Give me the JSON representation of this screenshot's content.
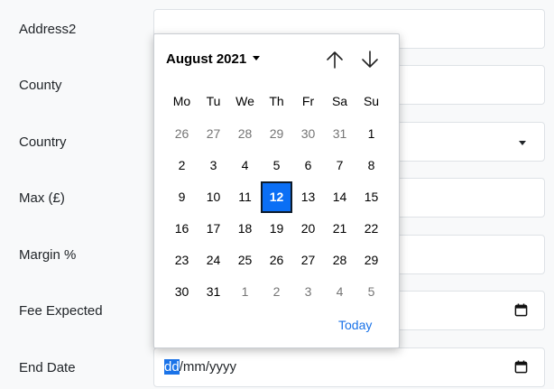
{
  "form": {
    "rows": [
      {
        "label": "Address2",
        "type": "text",
        "value": ""
      },
      {
        "label": "County",
        "type": "text",
        "value": ""
      },
      {
        "label": "Country",
        "type": "select",
        "value": ""
      },
      {
        "label": "Max (£)",
        "type": "text",
        "value": ""
      },
      {
        "label": "Margin %",
        "type": "text",
        "value": ""
      },
      {
        "label": "Fee Expected",
        "type": "date",
        "value": ""
      },
      {
        "label": "End Date",
        "type": "date",
        "value": ""
      }
    ],
    "end_date": {
      "seg_day": "dd",
      "sep1": "/",
      "seg_month": "mm",
      "sep2": "/",
      "seg_year": "yyyy"
    }
  },
  "datepicker": {
    "month_label": "August 2021",
    "weekdays": [
      "Mo",
      "Tu",
      "We",
      "Th",
      "Fr",
      "Sa",
      "Su"
    ],
    "days": [
      {
        "d": "26",
        "out": true
      },
      {
        "d": "27",
        "out": true
      },
      {
        "d": "28",
        "out": true
      },
      {
        "d": "29",
        "out": true
      },
      {
        "d": "30",
        "out": true
      },
      {
        "d": "31",
        "out": true
      },
      {
        "d": "1",
        "out": false
      },
      {
        "d": "2",
        "out": false
      },
      {
        "d": "3",
        "out": false
      },
      {
        "d": "4",
        "out": false
      },
      {
        "d": "5",
        "out": false
      },
      {
        "d": "6",
        "out": false
      },
      {
        "d": "7",
        "out": false
      },
      {
        "d": "8",
        "out": false
      },
      {
        "d": "9",
        "out": false
      },
      {
        "d": "10",
        "out": false
      },
      {
        "d": "11",
        "out": false
      },
      {
        "d": "12",
        "out": false,
        "selected": true
      },
      {
        "d": "13",
        "out": false
      },
      {
        "d": "14",
        "out": false
      },
      {
        "d": "15",
        "out": false
      },
      {
        "d": "16",
        "out": false
      },
      {
        "d": "17",
        "out": false
      },
      {
        "d": "18",
        "out": false
      },
      {
        "d": "19",
        "out": false
      },
      {
        "d": "20",
        "out": false
      },
      {
        "d": "21",
        "out": false
      },
      {
        "d": "22",
        "out": false
      },
      {
        "d": "23",
        "out": false
      },
      {
        "d": "24",
        "out": false
      },
      {
        "d": "25",
        "out": false
      },
      {
        "d": "26",
        "out": false
      },
      {
        "d": "27",
        "out": false
      },
      {
        "d": "28",
        "out": false
      },
      {
        "d": "29",
        "out": false
      },
      {
        "d": "30",
        "out": false
      },
      {
        "d": "31",
        "out": false
      },
      {
        "d": "1",
        "out": true
      },
      {
        "d": "2",
        "out": true
      },
      {
        "d": "3",
        "out": true
      },
      {
        "d": "4",
        "out": true
      },
      {
        "d": "5",
        "out": true
      }
    ],
    "today_label": "Today",
    "prev_icon": "arrow-up-icon",
    "next_icon": "arrow-down-icon"
  },
  "colors": {
    "selected_day": "#0b6ff5",
    "link": "#1a73e8",
    "page_bg": "#f8f9fa"
  }
}
